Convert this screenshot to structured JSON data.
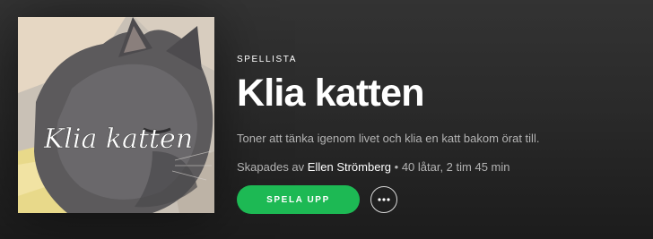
{
  "playlist": {
    "type_label": "SPELLISTA",
    "title": "Klia katten",
    "description": "Toner att tänka igenom livet och klia en katt bakom örat till.",
    "created_by_prefix": "Skapades av",
    "owner": "Ellen Strömberg",
    "separator": " • ",
    "stats": "40 låtar, 2 tim 45 min",
    "cover_text": "Klia katten"
  },
  "actions": {
    "play_label": "SPELA UPP",
    "more_icon": "ellipsis-icon"
  },
  "colors": {
    "accent": "#1db954",
    "secondary_text": "#b3b3b3"
  }
}
